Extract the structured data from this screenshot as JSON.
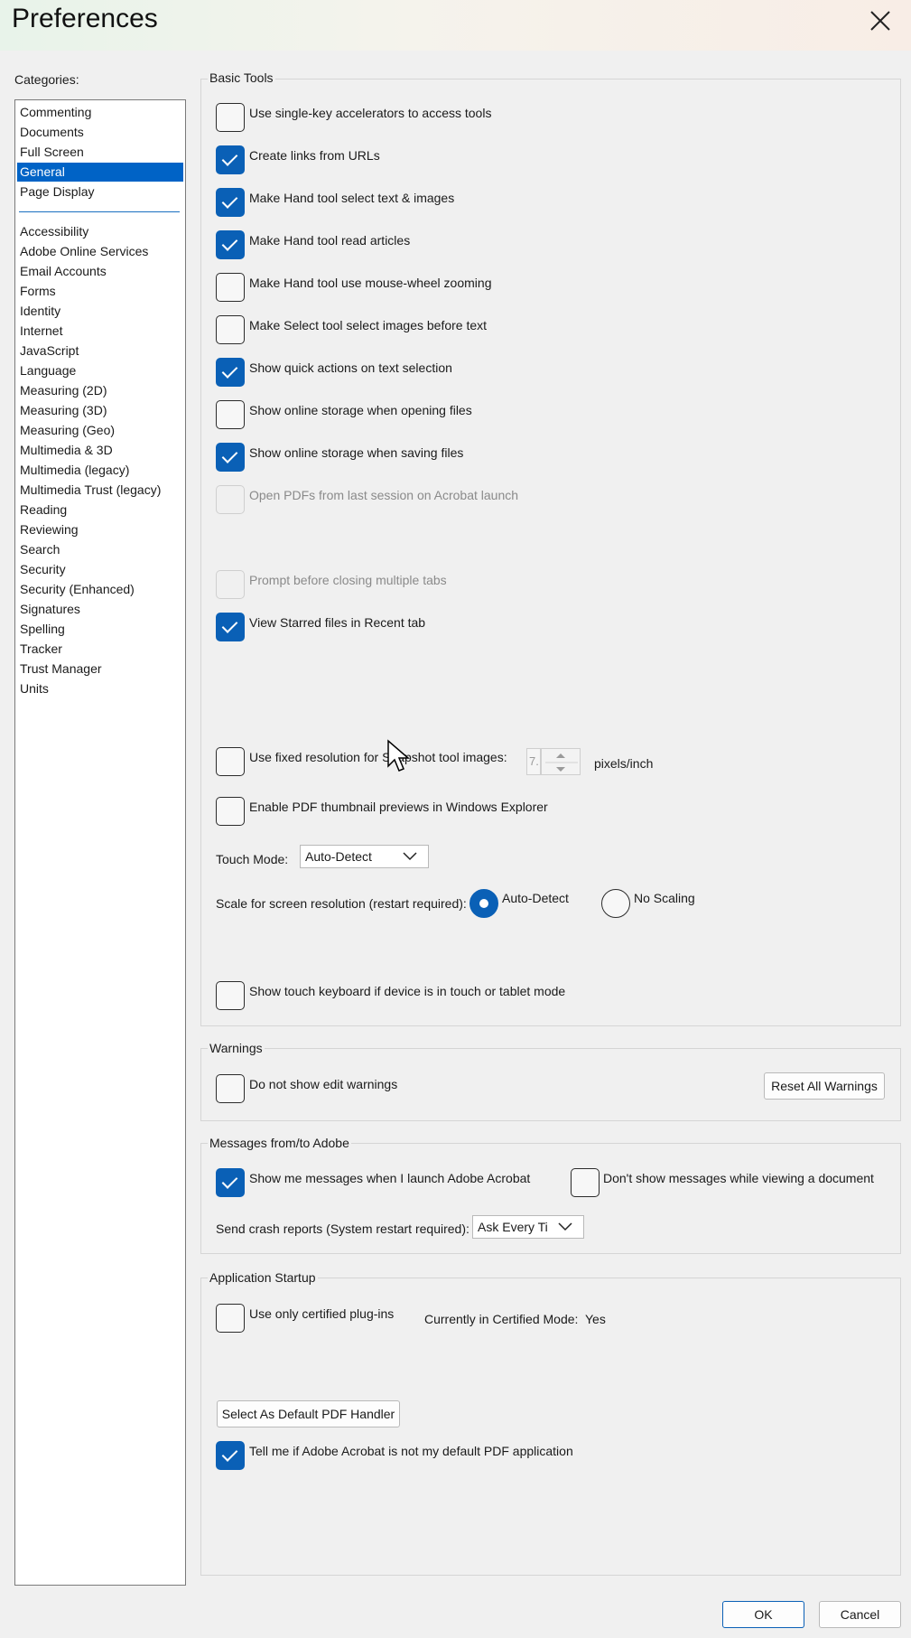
{
  "window": {
    "title": "Preferences"
  },
  "categories": {
    "label": "Categories:",
    "items_top": [
      "Commenting",
      "Documents",
      "Full Screen",
      "General",
      "Page Display"
    ],
    "selected": "General",
    "items_bottom": [
      "Accessibility",
      "Adobe Online Services",
      "Email Accounts",
      "Forms",
      "Identity",
      "Internet",
      "JavaScript",
      "Language",
      "Measuring (2D)",
      "Measuring (3D)",
      "Measuring (Geo)",
      "Multimedia & 3D",
      "Multimedia (legacy)",
      "Multimedia Trust (legacy)",
      "Reading",
      "Reviewing",
      "Search",
      "Security",
      "Security (Enhanced)",
      "Signatures",
      "Spelling",
      "Tracker",
      "Trust Manager",
      "Units"
    ]
  },
  "basic_tools": {
    "title": "Basic Tools",
    "options": [
      {
        "label": "Use single-key accelerators to access tools",
        "checked": false,
        "enabled": true
      },
      {
        "label": "Create links from URLs",
        "checked": true,
        "enabled": true
      },
      {
        "label": "Make Hand tool select text & images",
        "checked": true,
        "enabled": true
      },
      {
        "label": "Make Hand tool read articles",
        "checked": true,
        "enabled": true
      },
      {
        "label": "Make Hand tool use mouse-wheel zooming",
        "checked": false,
        "enabled": true
      },
      {
        "label": "Make Select tool select images before text",
        "checked": false,
        "enabled": true
      },
      {
        "label": "Show quick actions on text selection",
        "checked": true,
        "enabled": true
      },
      {
        "label": "Show online storage when opening files",
        "checked": false,
        "enabled": true
      },
      {
        "label": "Show online storage when saving files",
        "checked": true,
        "enabled": true
      },
      {
        "label": "Open PDFs from last session on Acrobat launch",
        "checked": false,
        "enabled": false
      },
      {
        "label": "Prompt before closing multiple tabs",
        "checked": false,
        "enabled": false
      },
      {
        "label": "View Starred files in Recent tab",
        "checked": true,
        "enabled": true
      },
      {
        "label": "Use fixed resolution for Snapshot tool images:",
        "checked": false,
        "enabled": true
      },
      {
        "label": "Enable PDF thumbnail previews in Windows Explorer",
        "checked": false,
        "enabled": true
      },
      {
        "label": "Show touch keyboard if device is in touch or tablet mode",
        "checked": false,
        "enabled": true
      }
    ],
    "snapshot_resolution": {
      "value": "7.",
      "unit": "pixels/inch"
    },
    "touch_mode": {
      "label": "Touch Mode:",
      "value": "Auto-Detect"
    },
    "scale": {
      "label": "Scale for screen resolution (restart required):",
      "option1": "Auto-Detect",
      "option2": "No Scaling",
      "selected": "Auto-Detect"
    }
  },
  "warnings": {
    "title": "Warnings",
    "option": {
      "label": "Do not show edit warnings",
      "checked": false
    },
    "reset_button": "Reset All Warnings"
  },
  "messages": {
    "title": "Messages from/to Adobe",
    "option1": {
      "label": "Show me messages when I launch Adobe Acrobat",
      "checked": true
    },
    "option2": {
      "label": "Don't show messages while viewing a document",
      "checked": false
    },
    "crash_label": "Send crash reports (System restart required):",
    "crash_value": "Ask Every Ti"
  },
  "startup": {
    "title": "Application Startup",
    "certified": {
      "label": "Use only certified plug-ins",
      "checked": false
    },
    "certified_mode_label": "Currently in Certified Mode:",
    "certified_mode_value": "Yes",
    "default_handler_button": "Select As Default PDF Handler",
    "tell_me": {
      "label": "Tell me if Adobe Acrobat is not my default PDF application",
      "checked": true
    }
  },
  "footer": {
    "ok": "OK",
    "cancel": "Cancel"
  }
}
